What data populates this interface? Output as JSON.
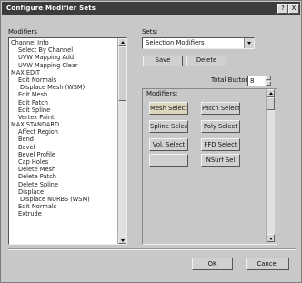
{
  "window": {
    "title": "Configure Modifier Sets",
    "help_label": "?",
    "close_label": "X"
  },
  "modifiers_label": "Modifiers",
  "modifier_list": [
    {
      "label": "Channel Info",
      "level": 0
    },
    {
      "label": "Select By Channel",
      "level": 1
    },
    {
      "label": "UVW Mapping Add",
      "level": 1
    },
    {
      "label": "UVW Mapping Clear",
      "level": 1
    },
    {
      "label": "MAX EDIT",
      "level": 0
    },
    {
      "label": "Edit Normals",
      "level": 1
    },
    {
      "label": "Displace Mesh (WSM)",
      "level": 2
    },
    {
      "label": "Edit Mesh",
      "level": 1
    },
    {
      "label": "Edit Patch",
      "level": 1
    },
    {
      "label": "Edit Spline",
      "level": 1
    },
    {
      "label": "Vertex Paint",
      "level": 1
    },
    {
      "label": "MAX STANDARD",
      "level": 0
    },
    {
      "label": "Affect Region",
      "level": 1
    },
    {
      "label": "Bend",
      "level": 1
    },
    {
      "label": "Bevel",
      "level": 1
    },
    {
      "label": "Bevel Profile",
      "level": 1
    },
    {
      "label": "Cap Holes",
      "level": 1
    },
    {
      "label": "Delete Mesh",
      "level": 1
    },
    {
      "label": "Delete Patch",
      "level": 1
    },
    {
      "label": "Delete Spline",
      "level": 1
    },
    {
      "label": "Displace",
      "level": 1
    },
    {
      "label": "Displace NURBS (WSM)",
      "level": 2
    },
    {
      "label": "Edit Normals",
      "level": 1
    },
    {
      "label": "Extrude",
      "level": 1
    }
  ],
  "sets_label": "Sets:",
  "sets_value": "Selection Modifiers",
  "save_label": "Save",
  "delete_label": "Delete",
  "total_buttons_label": "Total Buttons:",
  "total_buttons_value": "8",
  "group_caption": "Modifiers:",
  "modifier_buttons": [
    "Mesh Select",
    "Patch Select",
    "Spline Select",
    "Poly Select",
    "Vol. Select",
    "FFD Select",
    "",
    "NSurf Sel"
  ],
  "ok_label": "OK",
  "cancel_label": "Cancel",
  "colors": {
    "titlebar": "#3c3c3c",
    "window_bg": "#c8c8c8",
    "selected_button": "#dcd7bd"
  }
}
